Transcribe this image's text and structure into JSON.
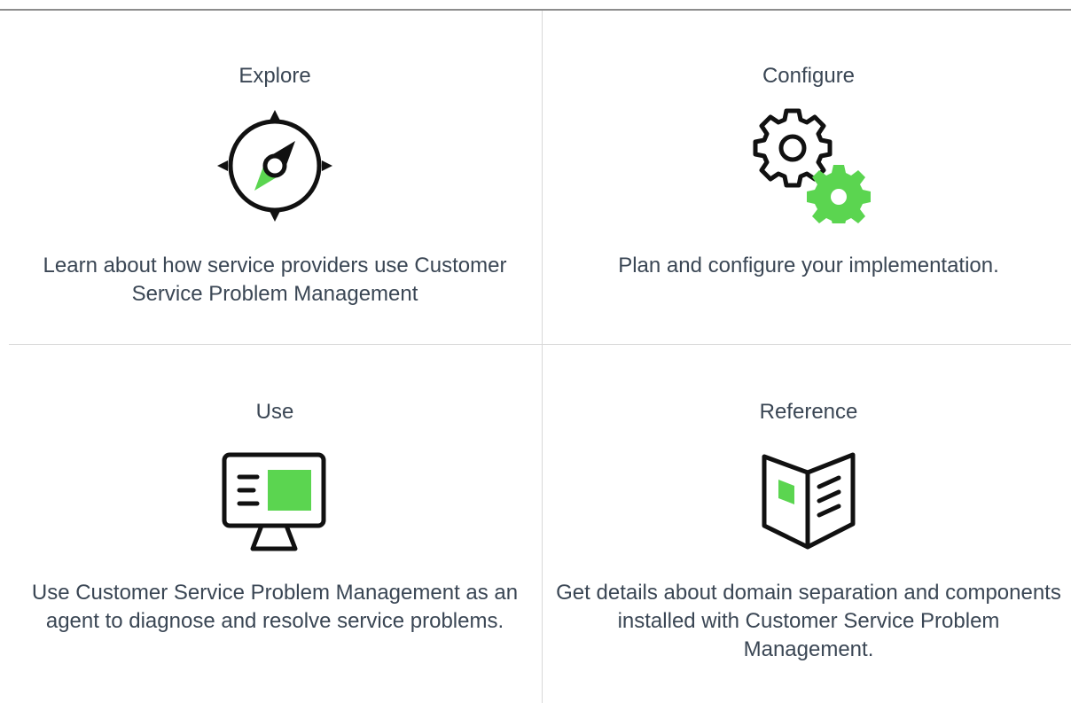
{
  "colors": {
    "text": "#3a4654",
    "accent_green": "#5bd550",
    "icon_stroke": "#111111",
    "divider": "#d8d8d8"
  },
  "cards": [
    {
      "title": "Explore",
      "icon": "compass-icon",
      "description": "Learn about how service providers use Customer Service Problem Management"
    },
    {
      "title": "Configure",
      "icon": "gears-icon",
      "description": "Plan and configure your implementation."
    },
    {
      "title": "Use",
      "icon": "monitor-icon",
      "description": "Use Customer Service Problem Management as an agent to diagnose and resolve service problems."
    },
    {
      "title": "Reference",
      "icon": "open-book-icon",
      "description": "Get details about domain separation and components installed with Customer Service Problem Management."
    }
  ]
}
